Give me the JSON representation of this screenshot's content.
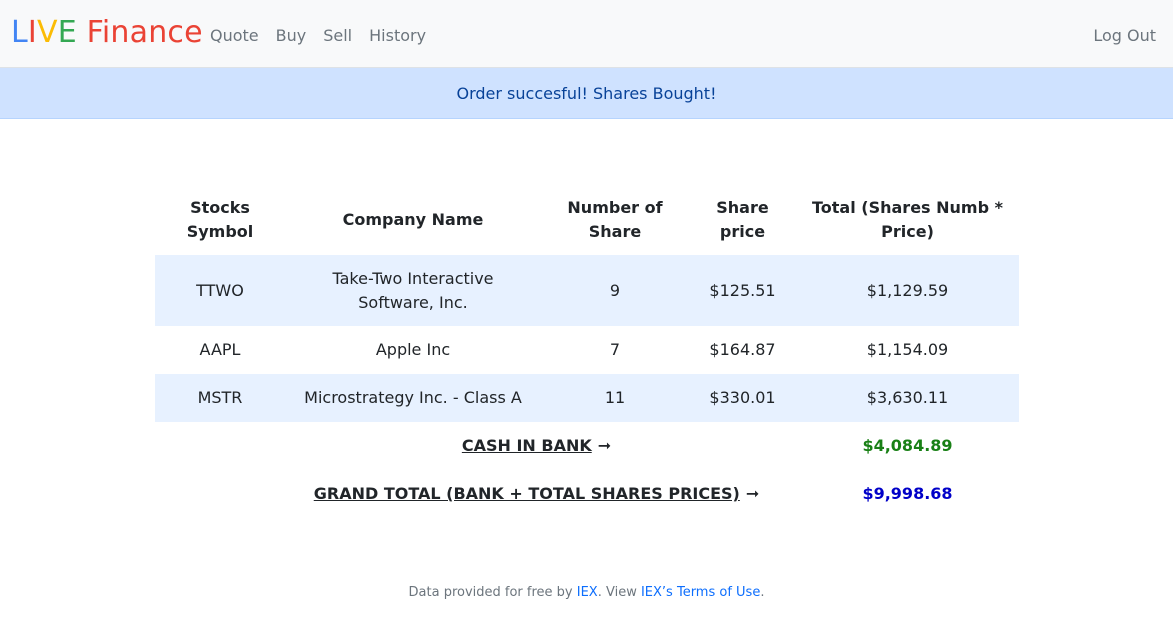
{
  "navbar": {
    "brand": {
      "letters": [
        {
          "char": "L",
          "color": "#4285f4"
        },
        {
          "char": "I",
          "color": "#ea4335"
        },
        {
          "char": "V",
          "color": "#fbbc05"
        },
        {
          "char": "E",
          "color": "#34a853"
        },
        {
          "char": " Finance",
          "color": "#ea4335"
        }
      ]
    },
    "links": [
      {
        "label": "Quote"
      },
      {
        "label": "Buy"
      },
      {
        "label": "Sell"
      },
      {
        "label": "History"
      }
    ],
    "logout_label": "Log Out"
  },
  "alert": {
    "message": "Order succesful! Shares Bought!"
  },
  "table": {
    "headers": {
      "symbol": "Stocks Symbol",
      "company": "Company Name",
      "shares": "Number of Share",
      "price": "Share price",
      "total": "Total (Shares Numb * Price)"
    },
    "rows": [
      {
        "symbol": "TTWO",
        "company": "Take-Two Interactive Software, Inc.",
        "shares": "9",
        "price": "$125.51",
        "total": "$1,129.59"
      },
      {
        "symbol": "AAPL",
        "company": "Apple Inc",
        "shares": "7",
        "price": "$164.87",
        "total": "$1,154.09"
      },
      {
        "symbol": "MSTR",
        "company": "Microstrategy Inc. - Class A",
        "shares": "11",
        "price": "$330.01",
        "total": "$3,630.11"
      }
    ],
    "cash": {
      "label": "CASH IN BANK",
      "arrow": "➞",
      "value": "$4,084.89",
      "color": "#198016"
    },
    "grand_total": {
      "label": "GRAND TOTAL (BANK + TOTAL SHARES PRICES)",
      "arrow": "➞",
      "value": "$9,998.68",
      "color": "#0000c8"
    }
  },
  "footer": {
    "prefix": "Data provided for free by ",
    "iex_link": "IEX",
    "middle": ". View ",
    "terms_link": "IEX’s Terms of Use",
    "suffix": "."
  }
}
